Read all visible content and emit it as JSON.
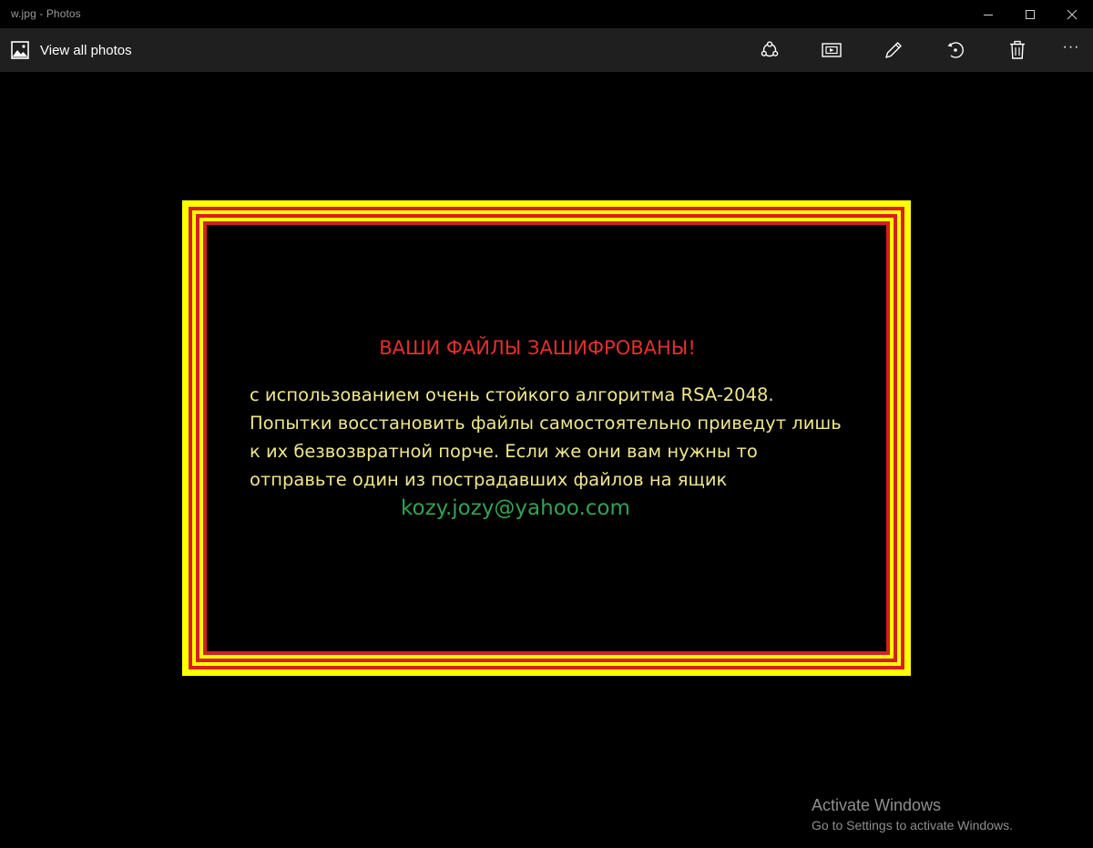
{
  "window": {
    "title": "w.jpg - Photos",
    "controls": [
      "minimize-icon",
      "maximize-icon",
      "close-icon"
    ]
  },
  "toolbar": {
    "view_all_label": "View all photos",
    "buttons": [
      "share-icon",
      "slideshow-icon",
      "edit-icon",
      "rotate-icon",
      "delete-icon",
      "more-icon"
    ]
  },
  "photo": {
    "title": "ВАШИ ФАЙЛЫ ЗАШИФРОВАНЫ!",
    "lines": [
      "с использованием очень стойкого алгоритма RSA-2048.",
      "Попытки восстановить файлы самостоятельно приведут лишь",
      "к их безвозвратной порче. Если же они вам нужны то",
      "отправьте один из пострадавших файлов на ящик"
    ],
    "email": "kozy.jozy@yahoo.com",
    "colors": {
      "outer": "#ffff00",
      "stripe": "#d42020",
      "title": "#e03030",
      "body": "#f0e68c",
      "email": "#35a055"
    }
  },
  "watermark": {
    "title": "Activate Windows",
    "subtitle": "Go to Settings to activate Windows."
  }
}
